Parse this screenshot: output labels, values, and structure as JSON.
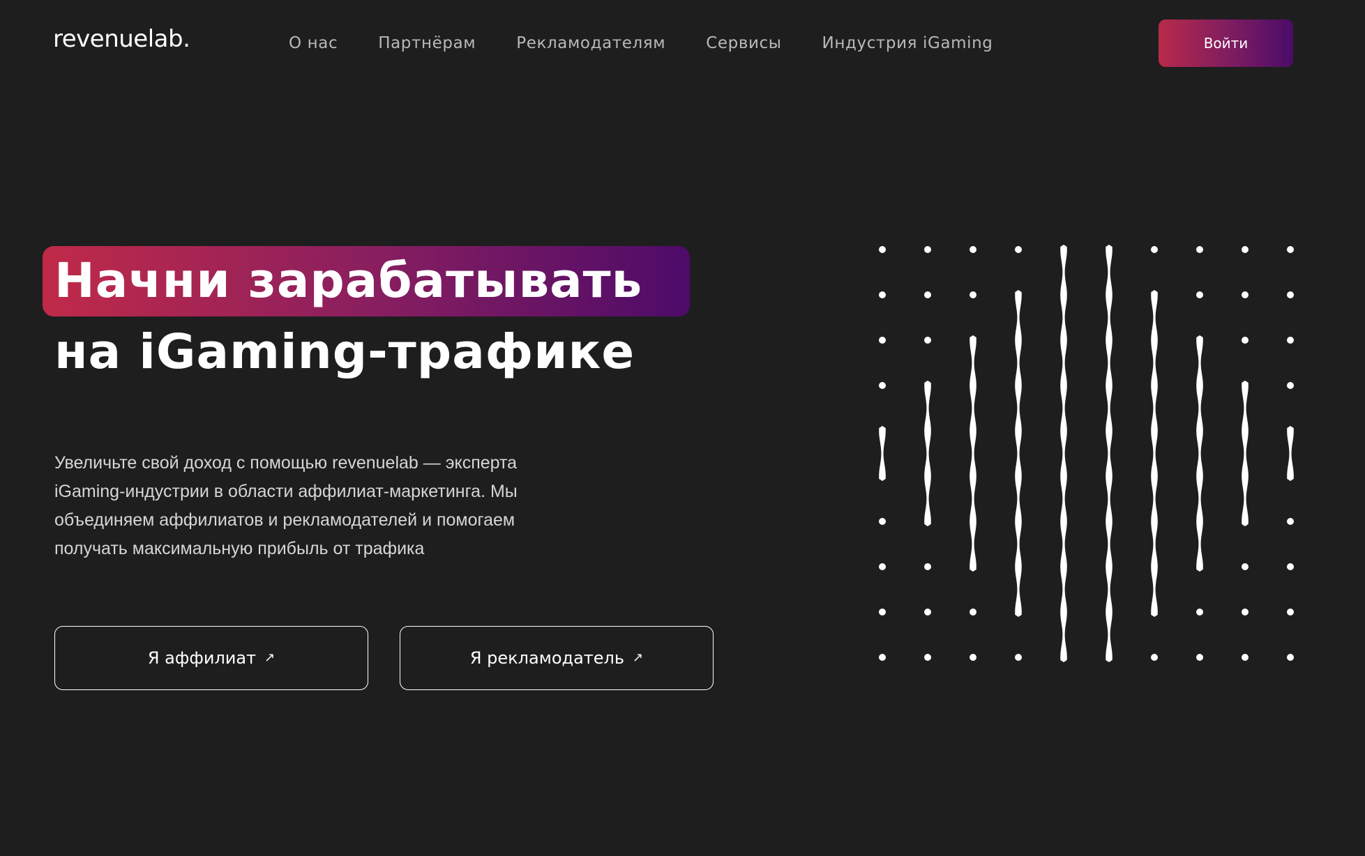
{
  "header": {
    "logo": "revenuelab.",
    "nav": [
      {
        "label": "О нас"
      },
      {
        "label": "Партнёрам"
      },
      {
        "label": "Рекламодателям"
      },
      {
        "label": "Сервисы"
      },
      {
        "label": "Индустрия iGaming"
      }
    ],
    "login_label": "Войти"
  },
  "hero": {
    "title_line1": "Начни зарабатывать",
    "title_line2": "на iGaming-трафике",
    "description": "Увеличьте свой доход с помощью revenuelab — эксперта iGaming-индустрии в области аффилиат-маркетинга. Мы объединяем аффилиатов и рекламодателей и помогаем получать максимальную прибыль от трафика",
    "buttons": [
      {
        "label": "Я аффилиат",
        "icon": "arrow-up-right-icon"
      },
      {
        "label": "Я рекламодатель",
        "icon": "arrow-up-right-icon"
      }
    ]
  },
  "colors": {
    "background": "#1e1e1f",
    "gradient_start": "#c02a48",
    "gradient_end": "#4d0b69",
    "text": "#ffffff",
    "nav_text": "#b9b9b9"
  }
}
